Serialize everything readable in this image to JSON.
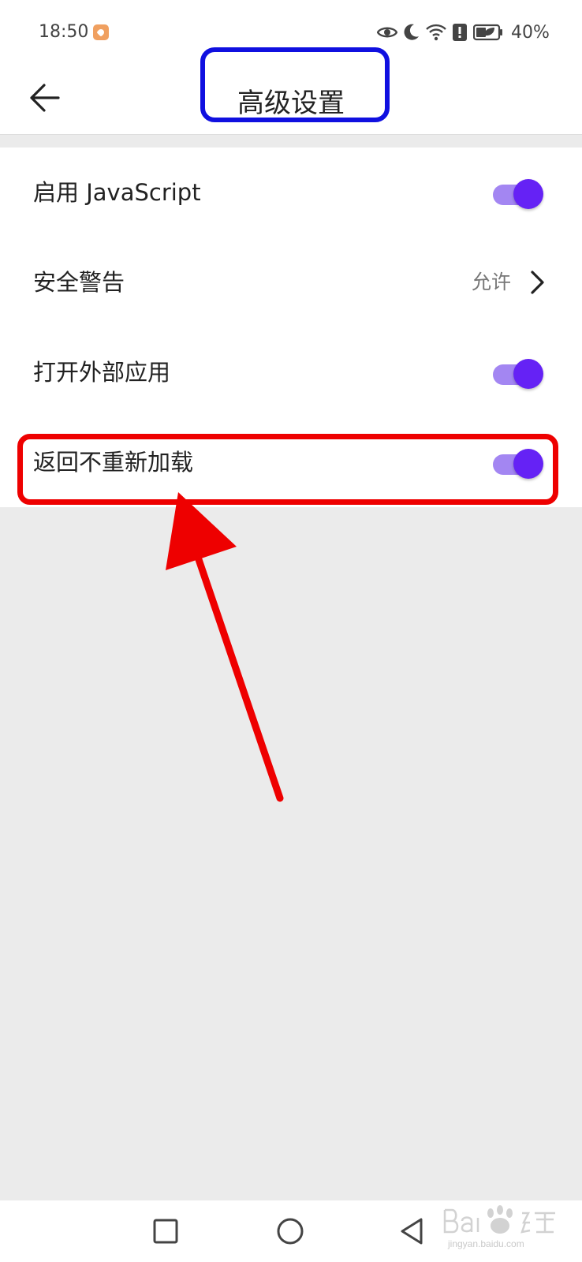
{
  "status_bar": {
    "time": "18:50",
    "battery_percent": "40%",
    "icons": [
      "app-notification-icon",
      "eye-icon",
      "moon-icon",
      "wifi-icon",
      "alert-icon",
      "battery-icon"
    ]
  },
  "header": {
    "title": "高级设置",
    "back_icon": "arrow-left-icon"
  },
  "settings": [
    {
      "label": "启用 JavaScript",
      "type": "toggle",
      "on": true
    },
    {
      "label": "安全警告",
      "type": "value",
      "value": "允许"
    },
    {
      "label": "打开外部应用",
      "type": "toggle",
      "on": true
    },
    {
      "label": "返回不重新加载",
      "type": "toggle",
      "on": true
    }
  ],
  "annotations": {
    "blue_box_color": "#1010e0",
    "red_box_color": "#ee0000",
    "arrow_color": "#ee0000"
  },
  "nav_bar": {
    "icons": [
      "recent-apps-icon",
      "home-icon",
      "back-triangle-icon"
    ]
  },
  "watermark": {
    "text": "jingyan.baidu.com"
  },
  "colors": {
    "toggle_track": "#a386f2",
    "toggle_thumb": "#6522f5",
    "background": "#ebebeb"
  }
}
